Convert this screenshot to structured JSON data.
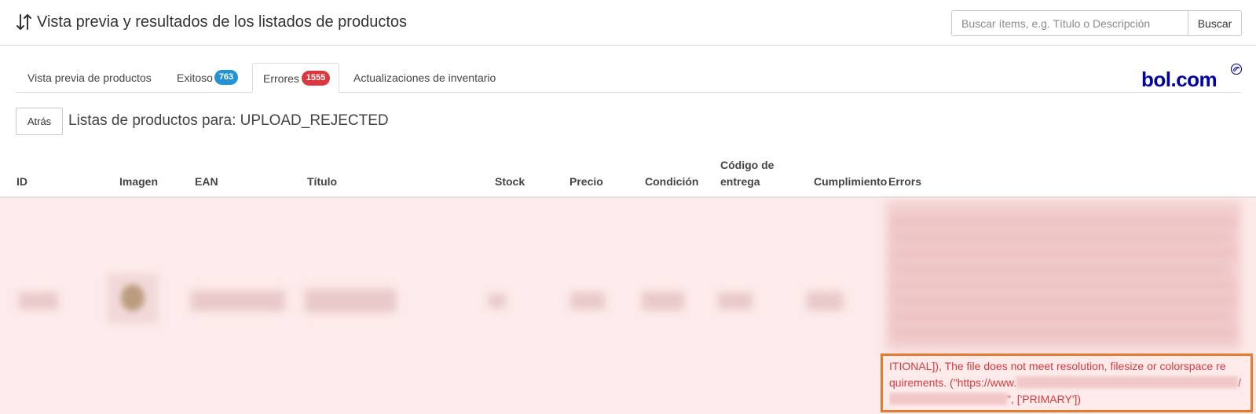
{
  "header": {
    "title": "Vista previa y resultados de los listados de productos",
    "search_placeholder": "Buscar ítems, e.g. Título o Descripción",
    "search_button": "Buscar"
  },
  "tabs": [
    {
      "label": "Vista previa de productos",
      "active": false
    },
    {
      "label": "Exitoso",
      "badge": "763",
      "badge_color": "#2493d4",
      "active": false
    },
    {
      "label": "Errores",
      "badge": "1555",
      "badge_color": "#d9393e",
      "active": true
    },
    {
      "label": "Actualizaciones de inventario",
      "active": false
    }
  ],
  "brand": {
    "name": "bol.com",
    "color": "#0000a4"
  },
  "subheader": {
    "back_button": "Atrás",
    "heading": "Listas de productos para: UPLOAD_REJECTED"
  },
  "table": {
    "columns": [
      {
        "label": "ID"
      },
      {
        "label": "Imagen"
      },
      {
        "label": "EAN"
      },
      {
        "label": "Título"
      },
      {
        "label": "Stock"
      },
      {
        "label": "Precio"
      },
      {
        "label": "Condición"
      },
      {
        "label": "Código de entrega",
        "line1": "Código de",
        "line2": "entrega"
      },
      {
        "label": "Cumplimiento"
      },
      {
        "label": "Errors"
      }
    ],
    "row_background": "#fdeaea",
    "error_text": {
      "line1": "ITIONAL]), The file does not meet resolution, filesize or colorspace re",
      "line2_prefix": "quirements. (\"https://www.",
      "line2_suffix": "/",
      "line3_suffix": "\", ['PRIMARY'])"
    },
    "error_color": "#d9393e",
    "highlight_color": "#e57b2d"
  }
}
